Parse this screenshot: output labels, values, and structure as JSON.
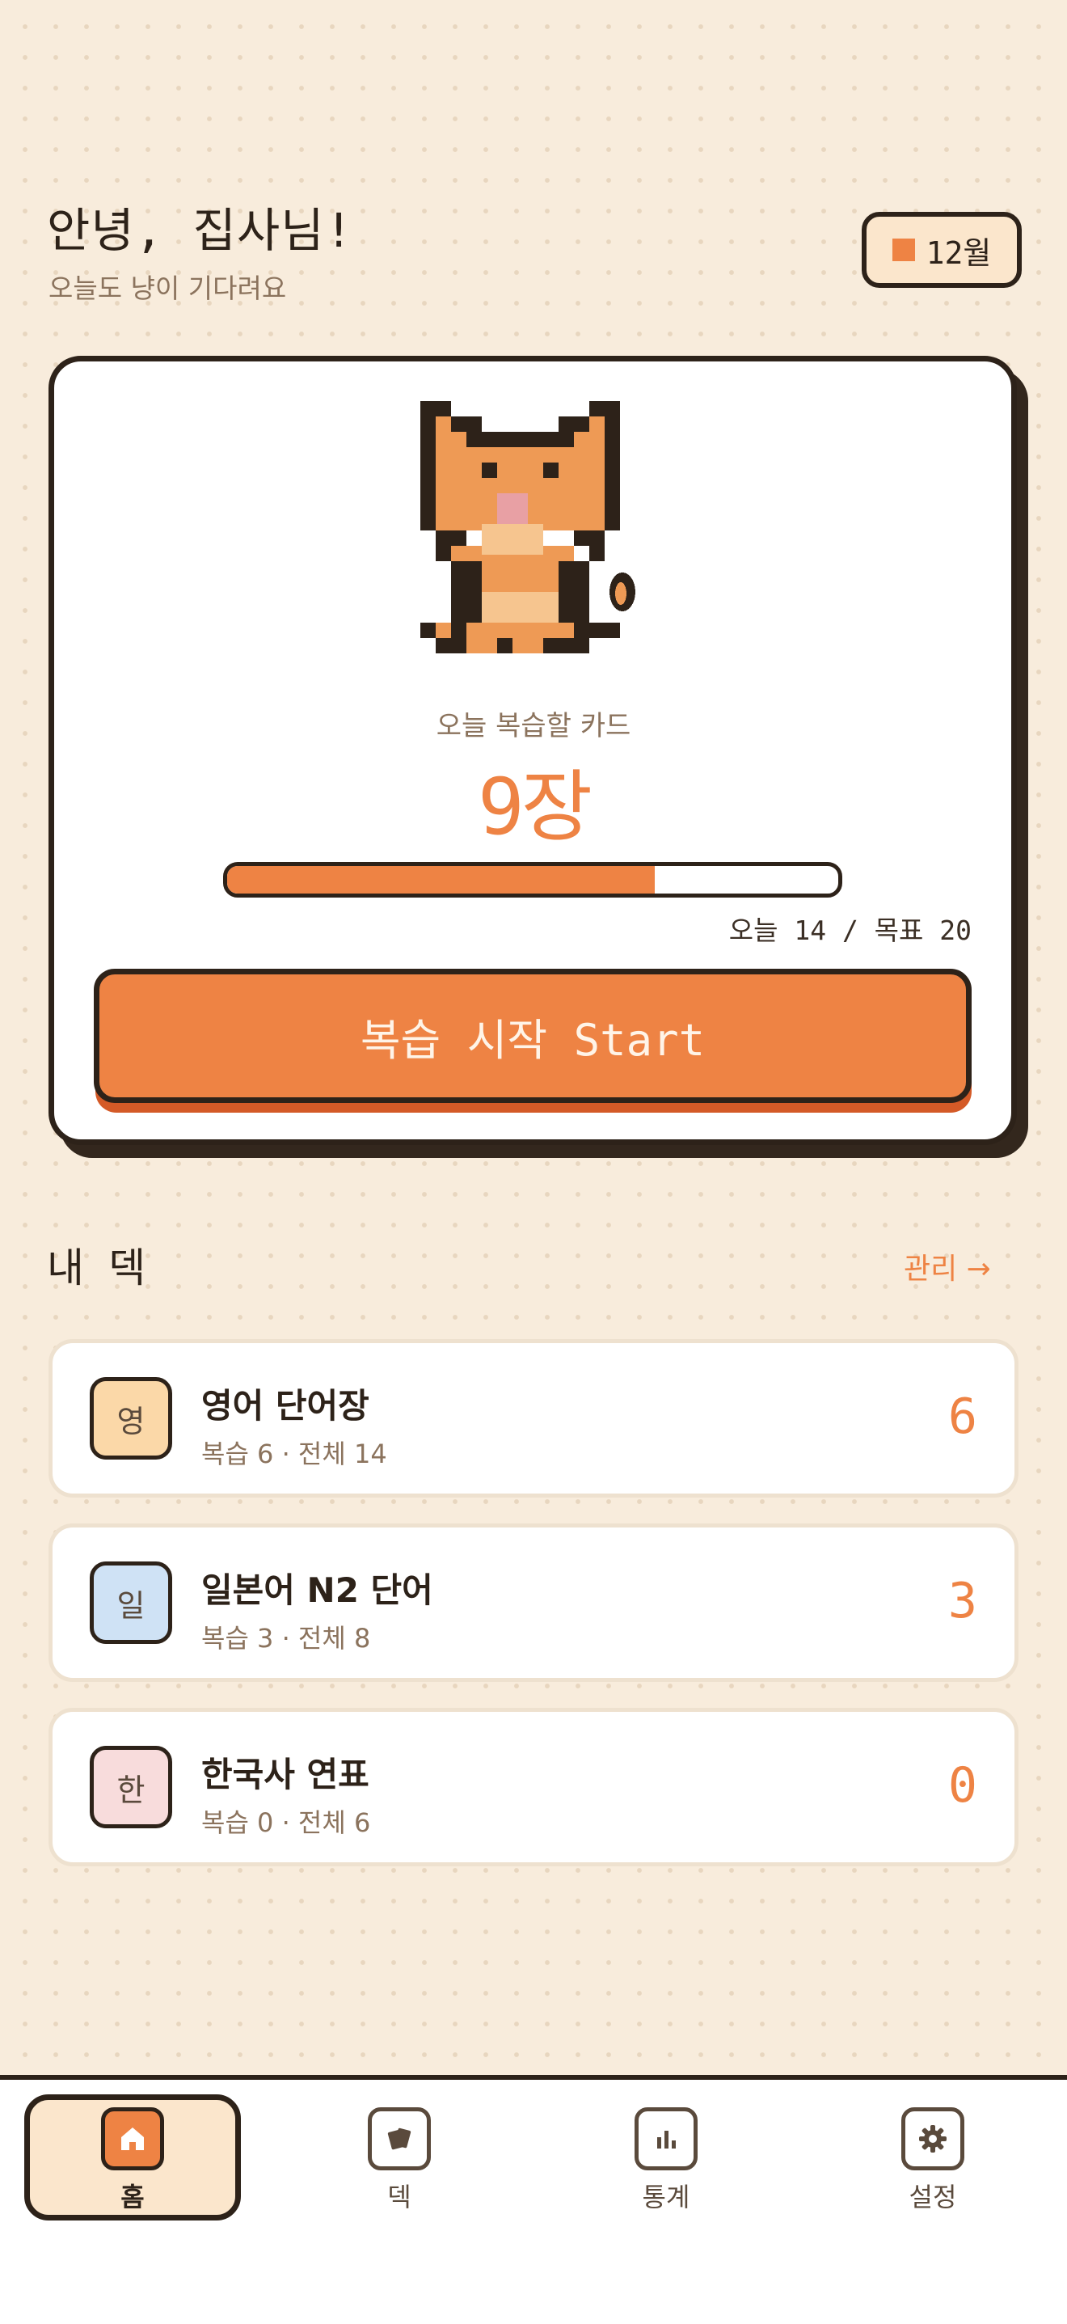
{
  "header": {
    "greeting": "안녕, 집사님!",
    "subtitle": "오늘도 냥이 기다려요",
    "date_chip": "12월"
  },
  "review_card": {
    "label": "오늘 복습할 카드",
    "count": "9장",
    "progress_fraction": 0.7,
    "goal_text": "오늘 14 / 목표 20",
    "start_button": "복습 시작 Start"
  },
  "decks_section": {
    "title": "내 덱",
    "manage_link": "관리 →",
    "decks": [
      {
        "icon_char": "영",
        "icon_color": "#fbd8a8",
        "title": "영어 단어장",
        "meta": "복습 6 · 전체 14",
        "count": "6"
      },
      {
        "icon_char": "일",
        "icon_color": "#cfe2f5",
        "title": "일본어 N2 단어",
        "meta": "복습 3 · 전체 8",
        "count": "3"
      },
      {
        "icon_char": "한",
        "icon_color": "#f8dcdc",
        "title": "한국사 연표",
        "meta": "복습 0 · 전체 6",
        "count": "0"
      }
    ]
  },
  "nav": {
    "items": [
      {
        "label": "홈",
        "icon": "home-icon",
        "active": true
      },
      {
        "label": "덱",
        "icon": "cards-icon",
        "active": false
      },
      {
        "label": "통계",
        "icon": "bar-chart-icon",
        "active": false
      },
      {
        "label": "설정",
        "icon": "gear-icon",
        "active": false
      }
    ]
  },
  "colors": {
    "accent": "#ee8344",
    "ink": "#2d2219",
    "background": "#f8ecdc"
  }
}
